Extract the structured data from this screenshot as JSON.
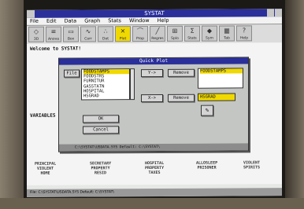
{
  "window": {
    "title": "SYSTAT"
  },
  "menu": [
    "File",
    "Edit",
    "Data",
    "Graph",
    "Stats",
    "Window",
    "Help"
  ],
  "toolbar": [
    {
      "label": "3D",
      "icon": "graph-3d-icon",
      "glyph": "◇"
    },
    {
      "label": "Anova",
      "icon": "anova-icon",
      "glyph": "≡"
    },
    {
      "label": "Box",
      "icon": "box-plot-icon",
      "glyph": "▭"
    },
    {
      "label": "Corr",
      "icon": "correlation-icon",
      "glyph": "∿"
    },
    {
      "label": "Dot",
      "icon": "dot-plot-icon",
      "glyph": "∴"
    },
    {
      "label": "Plot",
      "icon": "plot-icon",
      "glyph": "✕"
    },
    {
      "label": "Prop",
      "icon": "proportion-icon",
      "glyph": "⌒"
    },
    {
      "label": "Regres",
      "icon": "regression-icon",
      "glyph": "╱"
    },
    {
      "label": "Splo",
      "icon": "splom-icon",
      "glyph": "⊞"
    },
    {
      "label": "Stats",
      "icon": "stats-icon",
      "glyph": "Σ"
    },
    {
      "label": "Sym",
      "icon": "symbol-icon",
      "glyph": "◆"
    },
    {
      "label": "Tab",
      "icon": "table-icon",
      "glyph": "▦"
    },
    {
      "label": "Help",
      "icon": "help-icon",
      "glyph": "?"
    }
  ],
  "console": {
    "welcome": "Welcome to SYSTAT!",
    "variables_label": "VARIABLES"
  },
  "background_vars": [
    "PRINCIPAL\nVIOLENT\nHOME",
    "SECRETARY\nPROPERTY\nRESID",
    "HOSPITAL\nPROPERTY\nTAXES",
    "ALLOSLEEP\nPRISONER\n",
    "VIOLENT\nSPIRITS\n"
  ],
  "dialog": {
    "title": "Quick Plot",
    "file_button": "File",
    "source_list": [
      "FOODSTAMPS",
      "FOODSTRS",
      "FURNITUR",
      "GASSTATN",
      "HOSPITAL",
      "HSGRAD"
    ],
    "y_button": "Y->",
    "x_button": "X->",
    "remove_button_1": "Remove",
    "remove_button_2": "Remove",
    "y_list": [
      "FOODSTAMPS"
    ],
    "x_field": "HSGRAD",
    "ok": "OK",
    "cancel": "Cancel",
    "status": "C:\\SYSTAT\\USDATA.SYS   Default: C:\\SYSTAT\\"
  },
  "statusbar": "File: C:\\SYSTAT\\USDATA.SYS   Default: C:\\SYSTAT\\",
  "colors": {
    "title": "#2a2f9a",
    "highlight": "#f0d900"
  }
}
